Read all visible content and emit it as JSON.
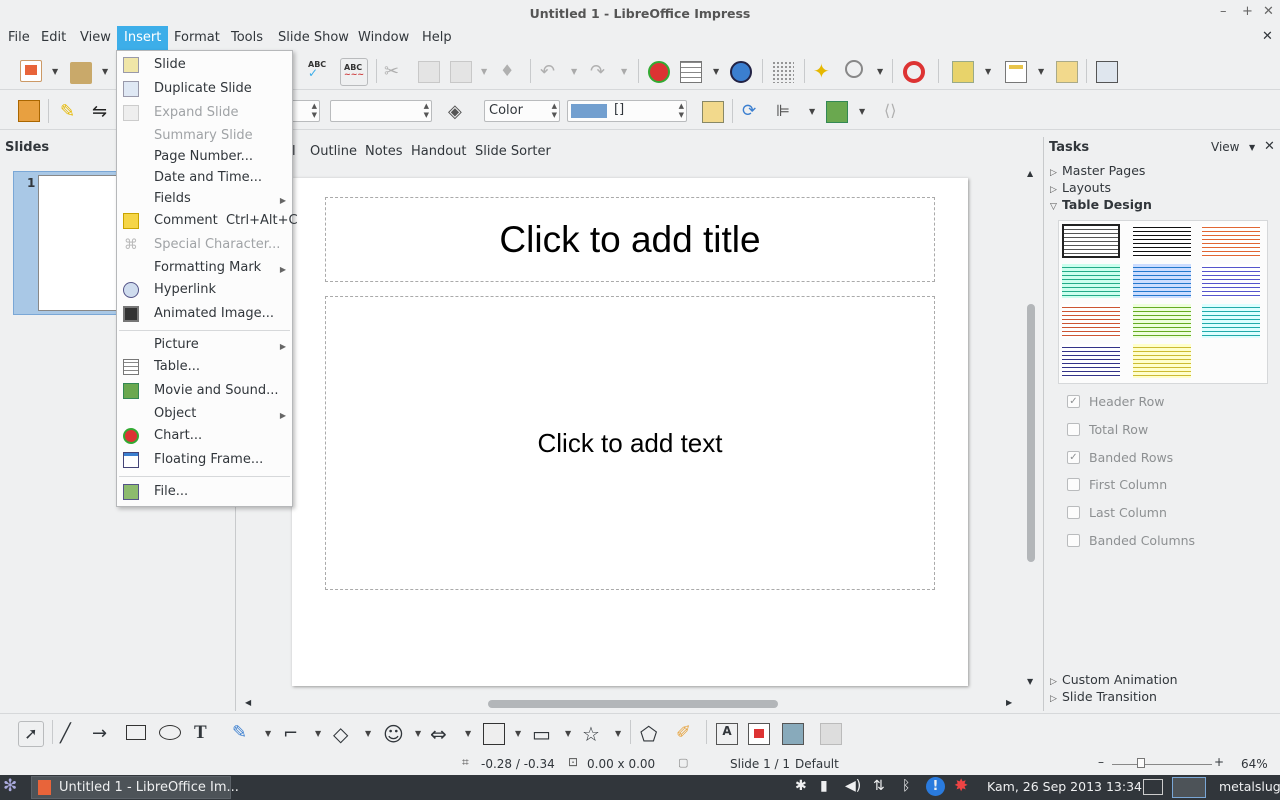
{
  "window": {
    "title": "Untitled 1 - LibreOffice Impress",
    "minimize": "–",
    "maximize": "+",
    "close": "✕",
    "doc_close": "✕"
  },
  "menubar": {
    "items": [
      "File",
      "Edit",
      "View",
      "Insert",
      "Format",
      "Tools",
      "Slide Show",
      "Window",
      "Help"
    ]
  },
  "line_props": {
    "area_style": "Color",
    "area_color_value": "[]"
  },
  "slides_pane": {
    "title": "Slides",
    "slide_number": "1"
  },
  "view_tabs": [
    "l",
    "Outline",
    "Notes",
    "Handout",
    "Slide Sorter"
  ],
  "slide": {
    "title_placeholder": "Click to add title",
    "text_placeholder": "Click to add text"
  },
  "tasks": {
    "title": "Tasks",
    "view_label": "View",
    "sections": [
      "Master Pages",
      "Layouts",
      "Table Design"
    ],
    "bottom_sections": [
      "Custom Animation",
      "Slide Transition"
    ],
    "table_options": [
      {
        "label": "Header Row",
        "checked": true
      },
      {
        "label": "Total Row",
        "checked": false
      },
      {
        "label": "Banded Rows",
        "checked": true
      },
      {
        "label": "First Column",
        "checked": false
      },
      {
        "label": "Last Column",
        "checked": false
      },
      {
        "label": "Banded Columns",
        "checked": false
      }
    ]
  },
  "insert_menu": {
    "items": [
      {
        "label": "Slide",
        "enabled": true
      },
      {
        "label": "Duplicate Slide",
        "enabled": true
      },
      {
        "label": "Expand Slide",
        "enabled": false
      },
      {
        "label": "Summary Slide",
        "enabled": false
      },
      {
        "label": "Page Number...",
        "enabled": true
      },
      {
        "label": "Date and Time...",
        "enabled": true
      },
      {
        "label": "Fields",
        "enabled": true,
        "submenu": true
      },
      {
        "label": "Comment",
        "shortcut": "Ctrl+Alt+C",
        "enabled": true
      },
      {
        "label": "Special Character...",
        "enabled": false
      },
      {
        "label": "Formatting Mark",
        "enabled": true,
        "submenu": true
      },
      {
        "label": "Hyperlink",
        "enabled": true
      },
      {
        "label": "Animated Image...",
        "enabled": true
      },
      {
        "label": "Picture",
        "enabled": true,
        "submenu": true
      },
      {
        "label": "Table...",
        "enabled": true
      },
      {
        "label": "Movie and Sound...",
        "enabled": true
      },
      {
        "label": "Object",
        "enabled": true,
        "submenu": true
      },
      {
        "label": "Chart...",
        "enabled": true
      },
      {
        "label": "Floating Frame...",
        "enabled": true
      },
      {
        "label": "File...",
        "enabled": true
      }
    ]
  },
  "statusbar": {
    "position": "-0.28 / -0.34",
    "size": "0.00 x 0.00",
    "slide": "Slide 1 / 1",
    "master": "Default",
    "zoom_minus": "–",
    "zoom_plus": "+",
    "zoom": "64%"
  },
  "taskbar": {
    "window_button": "Untitled 1 - LibreOffice Im...",
    "datetime": "Kam, 26 Sep 2013 13:34",
    "user": "metalslug"
  },
  "colors": {
    "accent": "#3daee9",
    "selection": "#a9c8e6",
    "taskbar": "#31363b"
  }
}
